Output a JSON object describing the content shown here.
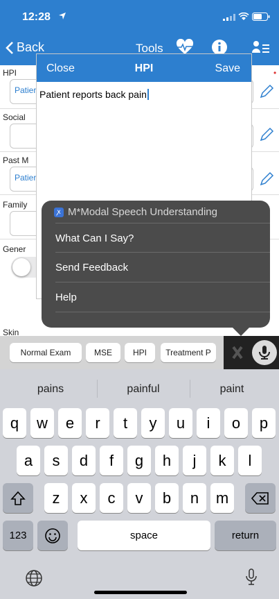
{
  "status": {
    "time": "12:28"
  },
  "nav": {
    "back_label": "Back",
    "tools_label": "Tools"
  },
  "form": {
    "rows": [
      {
        "label": "HPI",
        "value": "Patier"
      },
      {
        "label": "Social",
        "value": ""
      },
      {
        "label": "Past M",
        "value": "Patier"
      },
      {
        "label": "Family",
        "value": ""
      },
      {
        "label": "Gener",
        "value": ""
      }
    ],
    "skin_label": "Skin"
  },
  "modal": {
    "close_label": "Close",
    "title": "HPI",
    "save_label": "Save",
    "text": "Patient reports back pain"
  },
  "speech_menu": {
    "title": "M*Modal Speech Understanding",
    "items": [
      "What Can I Say?",
      "Send Feedback",
      "Help"
    ]
  },
  "quickbar": {
    "chips": [
      "Normal Exam",
      "MSE",
      "HPI",
      "Treatment P"
    ]
  },
  "keyboard": {
    "suggestions": [
      "pains",
      "painful",
      "paint"
    ],
    "row1": [
      "q",
      "w",
      "e",
      "r",
      "t",
      "y",
      "u",
      "i",
      "o",
      "p"
    ],
    "row2": [
      "a",
      "s",
      "d",
      "f",
      "g",
      "h",
      "j",
      "k",
      "l"
    ],
    "row3": [
      "z",
      "x",
      "c",
      "v",
      "b",
      "n",
      "m"
    ],
    "numbers_label": "123",
    "space_label": "space",
    "return_label": "return"
  },
  "colors": {
    "accent": "#2d7fcf",
    "popup": "#4b4b4b"
  }
}
